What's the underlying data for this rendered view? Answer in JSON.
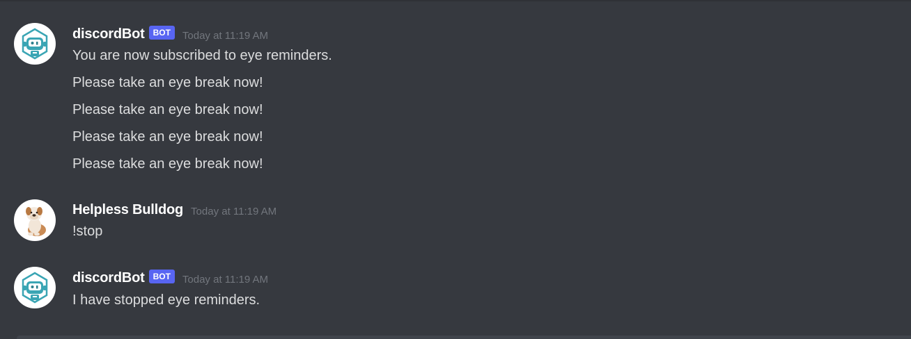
{
  "messages": [
    {
      "username": "discordBot",
      "bot_tag": "BOT",
      "timestamp": "Today at 11:19 AM",
      "avatar_icon": "robot-icon",
      "lines": [
        "You are now subscribed to eye reminders.",
        "Please take an eye break now!",
        "Please take an eye break now!",
        "Please take an eye break now!",
        "Please take an eye break now!"
      ]
    },
    {
      "username": "Helpless Bulldog",
      "timestamp": "Today at 11:19 AM",
      "avatar_icon": "bulldog-icon",
      "lines": [
        "!stop"
      ]
    },
    {
      "username": "discordBot",
      "bot_tag": "BOT",
      "timestamp": "Today at 11:19 AM",
      "avatar_icon": "robot-icon",
      "lines": [
        "I have stopped eye reminders."
      ]
    }
  ],
  "colors": {
    "background": "#36393f",
    "bot_tag": "#5865f2",
    "username": "#ffffff",
    "message_text": "#dcddde",
    "timestamp": "#72767d"
  }
}
